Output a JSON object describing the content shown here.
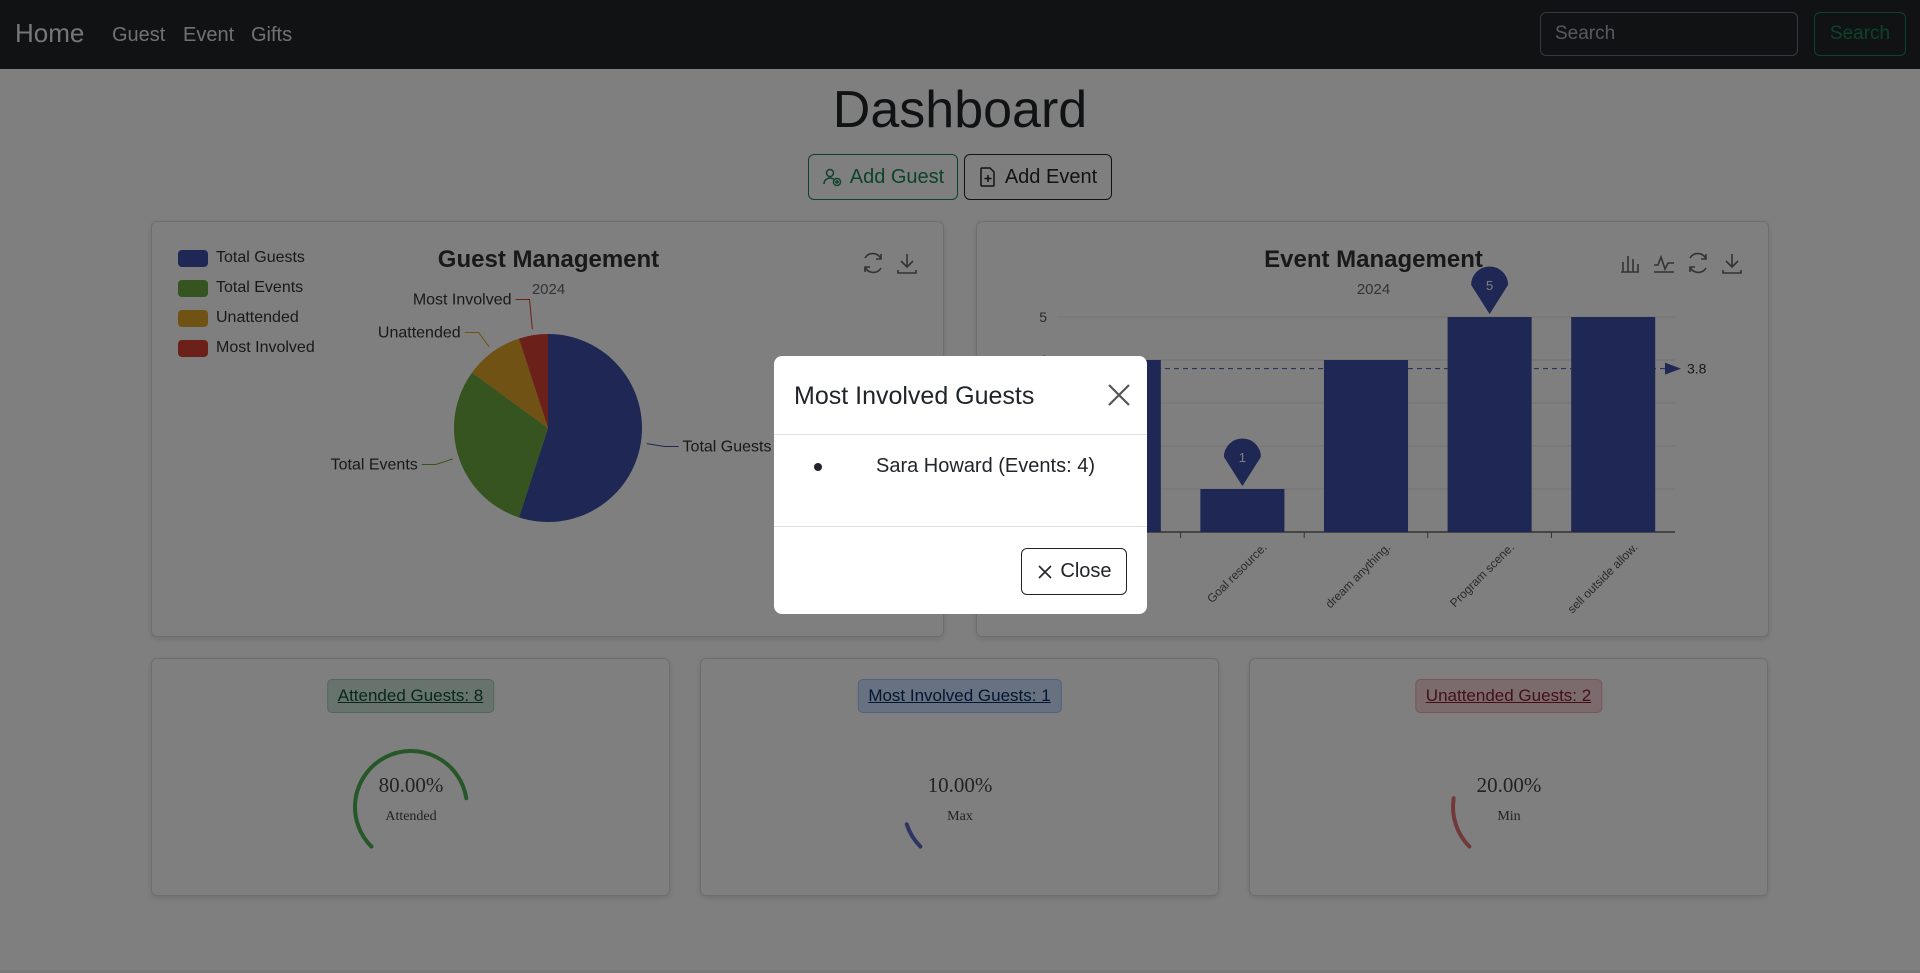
{
  "navbar": {
    "brand": "Home",
    "links": [
      "Guest",
      "Event",
      "Gifts"
    ],
    "search_placeholder": "Search",
    "search_button": "Search"
  },
  "page_title": "Dashboard",
  "actions": {
    "add_guest": "Add Guest",
    "add_event": "Add Event"
  },
  "guest_chart": {
    "title": "Guest Management",
    "subtitle": "2024",
    "legend": [
      "Total Guests",
      "Total Events",
      "Unattended",
      "Most Involved"
    ],
    "colors": [
      "#3e51a8",
      "#6aa83f",
      "#e0a52a",
      "#d64034"
    ]
  },
  "event_chart": {
    "title": "Event Management",
    "subtitle": "2024",
    "avg_label": "3.8",
    "max_pin": "5",
    "min_pin": "1",
    "bar_color": "#3e51a8"
  },
  "chart_data": [
    {
      "type": "pie",
      "title": "Guest Management",
      "subtitle": "2024",
      "categories": [
        "Total Guests",
        "Total Events",
        "Unattended",
        "Most Involved"
      ],
      "values": [
        55,
        30,
        10,
        5
      ]
    },
    {
      "type": "bar",
      "title": "Event Management",
      "subtitle": "2024",
      "categories": [
        "",
        "Goal resource.",
        "dream anything.",
        "Program scene.",
        "sell outside allow."
      ],
      "values": [
        4,
        1,
        4,
        5,
        5
      ],
      "ylim": [
        0,
        5
      ],
      "yticks": [
        "5",
        "4"
      ],
      "average": 3.8,
      "max_marker": 5,
      "min_marker": 1
    }
  ],
  "stats": [
    {
      "label": "Attended Guests: 8",
      "value": "80.00%",
      "caption": "Attended",
      "fraction": 0.8,
      "color": "#4caf50",
      "bg": "#d1e7dd",
      "text": "#0f5132",
      "border": "#a3cfbb"
    },
    {
      "label": "Most Involved Guests: 1",
      "value": "10.00%",
      "caption": "Max",
      "fraction": 0.1,
      "color": "#5c6bc0",
      "bg": "#cfe2ff",
      "text": "#052c65",
      "border": "#9ec5fe"
    },
    {
      "label": "Unattended Guests: 2",
      "value": "20.00%",
      "caption": "Min",
      "fraction": 0.2,
      "color": "#e57373",
      "bg": "#f8d7da",
      "text": "#842029",
      "border": "#f1aeb5"
    }
  ],
  "modal": {
    "title": "Most Involved Guests",
    "items": [
      "Sara Howard (Events: 4)"
    ],
    "close_label": "Close"
  }
}
